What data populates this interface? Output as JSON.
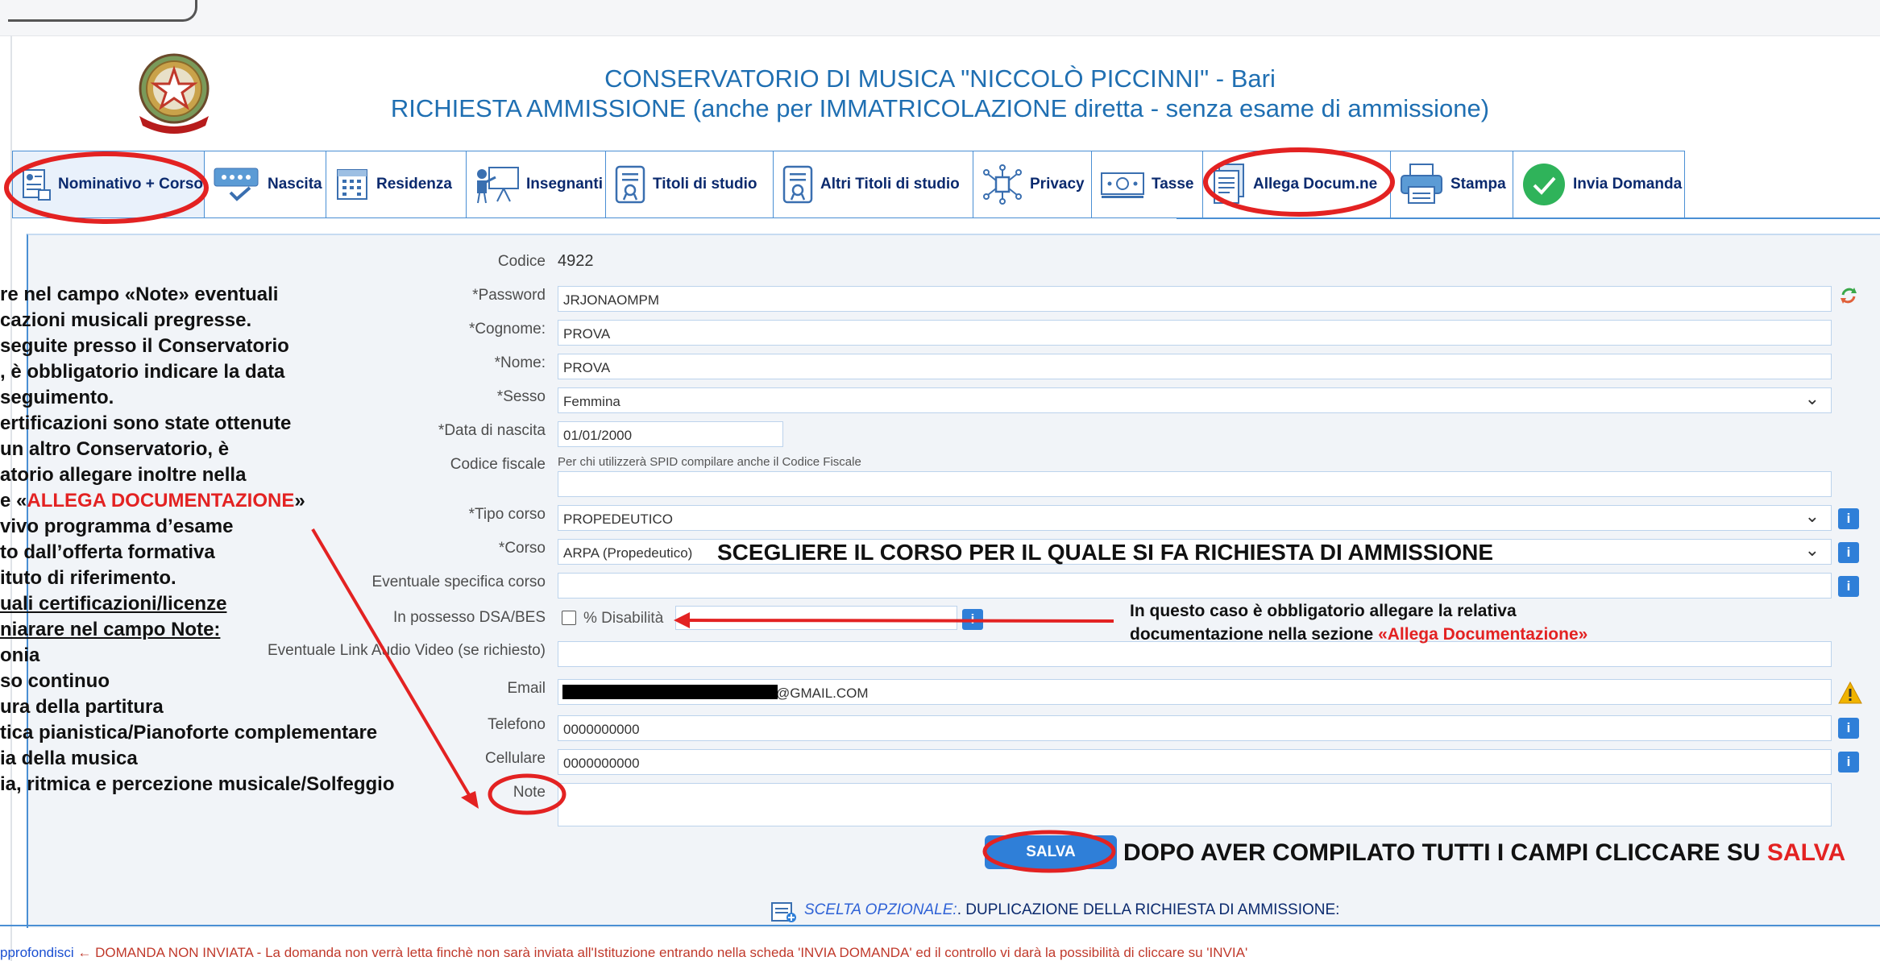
{
  "header": {
    "title_line1": "CONSERVATORIO DI MUSICA \"NICCOLÒ PICCINNI\" - Bari",
    "title_line2": "RICHIESTA AMMISSIONE (anche per IMMATRICOLAZIONE diretta - senza esame di ammissione)",
    "emblem_text": "REPUBBLICA ITALIANA"
  },
  "tabs": [
    {
      "label": "Nominativo + Corso",
      "icon": "user-form-icon"
    },
    {
      "label": "Nascita",
      "icon": "dots-check-icon"
    },
    {
      "label": "Residenza",
      "icon": "building-icon"
    },
    {
      "label": "Insegnanti",
      "icon": "teacher-board-icon"
    },
    {
      "label": "Titoli di studio",
      "icon": "certificate-icon"
    },
    {
      "label": "Altri Titoli di studio",
      "icon": "certificate-icon"
    },
    {
      "label": "Privacy",
      "icon": "network-icon"
    },
    {
      "label": "Tasse",
      "icon": "banknote-icon"
    },
    {
      "label": "Allega Docum.ne",
      "icon": "document-icon"
    },
    {
      "label": "Stampa",
      "icon": "printer-icon"
    },
    {
      "label": "Invia Domanda",
      "icon": "check-circle-icon"
    }
  ],
  "form": {
    "codice_label": "Codice",
    "codice_value": "4922",
    "password_label": "*Password",
    "password_value": "JRJONAOMPM",
    "cognome_label": "*Cognome:",
    "cognome_value": "PROVA",
    "nome_label": "*Nome:",
    "nome_value": "PROVA",
    "sesso_label": "*Sesso",
    "sesso_value": "Femmina",
    "nascita_label": "*Data di nascita",
    "nascita_value": "01/01/2000",
    "cf_label": "Codice fiscale",
    "cf_hint": "Per chi utilizzerà SPID compilare anche il Codice Fiscale",
    "cf_value": "",
    "tipo_label": "*Tipo corso",
    "tipo_value": "PROPEDEUTICO",
    "corso_label": "*Corso",
    "corso_value": "ARPA (Propedeutico)",
    "spec_label": "Eventuale specifica corso",
    "spec_value": "",
    "dsa_label": "In possesso DSA/BES",
    "dsa_check_label": "% Disabilità",
    "link_label": "Eventuale Link Audio Video (se richiesto)",
    "link_value": "",
    "email_label": "Email",
    "email_value": "@GMAIL.COM",
    "telefono_label": "Telefono",
    "telefono_value": "0000000000",
    "cellulare_label": "Cellulare",
    "cellulare_value": "0000000000",
    "note_label": "Note",
    "note_value": "",
    "save_label": "SALVA",
    "info_glyph": "i",
    "warn_glyph": "!"
  },
  "annotations": {
    "left_note_lines": [
      "re nel campo «Note» eventuali",
      "cazioni musicali pregresse.",
      "seguite presso il Conservatorio",
      ", è obbligatorio indicare la data",
      "seguimento.",
      "ertificazioni sono state ottenute",
      "un altro Conservatorio, è",
      "atorio allegare inoltre nella",
      "vivo programma d’esame",
      "to dall’offerta formativa",
      "ituto di riferimento.",
      "uali certificazioni/licenze",
      "niarare nel campo Note:",
      "onia",
      "so continuo",
      "ura della partitura",
      "tica pianistica/Pianoforte complementare",
      "ia della musica",
      "ia, ritmica e percezione musicale/Solfeggio"
    ],
    "left_note_allega_prefix": "e «",
    "left_note_allega_red": "ALLEGA DOCUMENTAZIONE",
    "left_note_allega_suffix": "»",
    "course_note": "SCEGLIERE IL CORSO PER IL QUALE SI FA RICHIESTA DI AMMISSIONE",
    "dsa_note_line1": "In questo caso è obbligatorio allegare la relativa",
    "dsa_note_line2_prefix": "documentazione nella sezione ",
    "dsa_note_line2_red": "«Allega Documentazione»",
    "salva_note_prefix": "DOPO AVER COMPILATO TUTTI I CAMPI CLICCARE SU ",
    "salva_note_red": "SALVA"
  },
  "optional": {
    "italic": "SCELTA OPZIONALE:",
    "text": ". DUPLICAZIONE DELLA RICHIESTA DI AMMISSIONE:"
  },
  "footer": {
    "link": "pprofondisci",
    "text": " ← DOMANDA NON INVIATA - La domanda non verrà letta finchè non sarà inviata all'Istituzione entrando nella scheda 'INVIA DOMANDA' ed il controllo vi darà la possibilità di cliccare su 'INVIA'"
  },
  "colors": {
    "title_blue": "#1f6fb2",
    "tab_border": "#4a8fd4",
    "annotation_red": "#e32222",
    "footer_red": "#c0392b",
    "button_blue": "#2f7fd8"
  }
}
